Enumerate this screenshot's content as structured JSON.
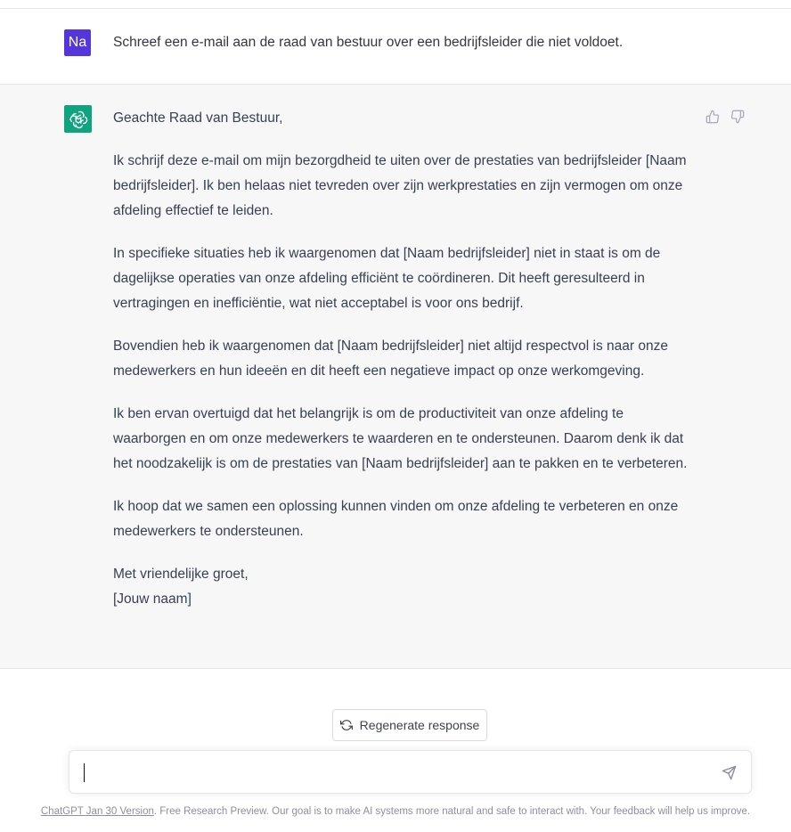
{
  "conversation": {
    "user": {
      "avatar_initials": "Na",
      "avatar_color": "#5436da",
      "message": "Schreef een e-mail aan de raad van bestuur over een bedrijfsleider die niet voldoet."
    },
    "assistant": {
      "avatar_icon": "openai-logo-icon",
      "avatar_color": "#10a37f",
      "greeting": "Geachte Raad van Bestuur,",
      "paragraphs": [
        "Ik schrijf deze e-mail om mijn bezorgdheid te uiten over de prestaties van bedrijfsleider [Naam bedrijfsleider]. Ik ben helaas niet tevreden over zijn werkprestaties en zijn vermogen om onze afdeling effectief te leiden.",
        "In specifieke situaties heb ik waargenomen dat [Naam bedrijfsleider] niet in staat is om de dagelijkse operaties van onze afdeling efficiënt te coördineren. Dit heeft geresulteerd in vertragingen en inefficiëntie, wat niet acceptabel is voor ons bedrijf.",
        "Bovendien heb ik waargenomen dat [Naam bedrijfsleider] niet altijd respectvol is naar onze medewerkers en hun ideeën en dit heeft een negatieve impact op onze werkomgeving.",
        "Ik ben ervan overtuigd dat het belangrijk is om de productiviteit van onze afdeling te waarborgen en om onze medewerkers te waarderen en te ondersteunen. Daarom denk ik dat het noodzakelijk is om de prestaties van [Naam bedrijfsleider] aan te pakken en te verbeteren.",
        "Ik hoop dat we samen een oplossing kunnen vinden om onze afdeling te verbeteren en onze medewerkers te ondersteunen."
      ],
      "closing": "Met vriendelijke groet,",
      "signature": "[Jouw naam]"
    }
  },
  "actions": {
    "regenerate_label": "Regenerate response"
  },
  "composer": {
    "placeholder": ""
  },
  "footer": {
    "version_link": "ChatGPT Jan 30 Version",
    "text": ". Free Research Preview. Our goal is to make AI systems more natural and safe to interact with. Your feedback will help us improve."
  }
}
